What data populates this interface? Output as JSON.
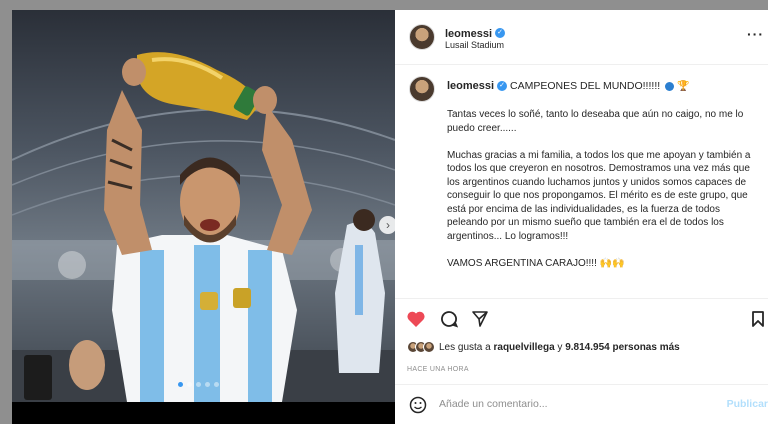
{
  "post": {
    "username": "leomessi",
    "location": "Lusail Stadium",
    "caption_title": "CAMPEONES DEL MUNDO!!!!!!",
    "caption_paragraphs": [
      "Tantas veces lo soñé, tanto lo deseaba que aún no caigo, no me lo puedo creer......",
      "Muchas gracias a mi familia, a todos los que me apoyan y también a todos los que creyeron en nosotros. Demostramos una vez más que los argentinos cuando luchamos juntos y unidos somos capaces de conseguir lo que nos propongamos. El mérito es de este grupo, que está por encima de las individualidades, es la fuerza de todos peleando por un mismo sueño que también era el de todos los argentinos... Lo logramos!!!"
    ],
    "caption_closing": "VAMOS ARGENTINA CARAJO!!!!",
    "likes": {
      "prefix": "Les gusta a",
      "user": "raquelvillega",
      "connector": "y",
      "count": "9.814.954 personas más"
    },
    "time_ago": "HACE UNA HORA"
  },
  "comment": {
    "placeholder": "Añade un comentario...",
    "publish_label": "Publicar"
  },
  "icons": {
    "verified": "verified-badge-icon",
    "more": "more-options-icon",
    "like": "heart-icon",
    "comment": "comment-bubble-icon",
    "share": "paper-plane-icon",
    "save": "bookmark-icon",
    "emoji": "smiley-icon",
    "next": "chevron-right-icon"
  },
  "colors": {
    "like_active": "#ed4956",
    "verified": "#3897f0",
    "publish_disabled": "#b2dffc"
  }
}
